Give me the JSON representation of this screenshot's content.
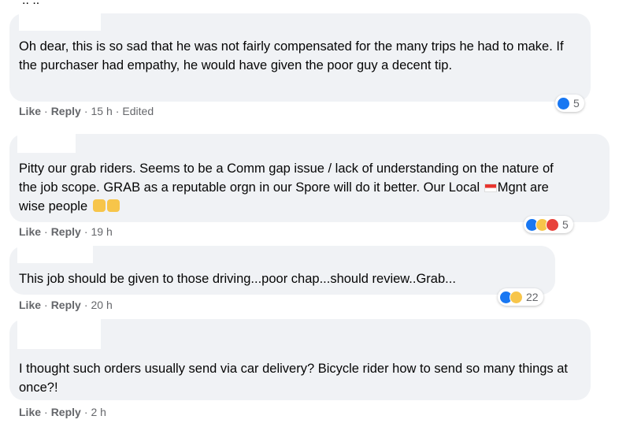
{
  "top_fragment": ".. ..",
  "comments": [
    {
      "text": "Oh dear, this is so sad that he was not fairly compensated for the many trips he had to make. If the purchaser had empathy, he would have given the poor guy a decent tip.",
      "like_label": "Like",
      "reply_label": "Reply",
      "time": "15 h",
      "edited": "Edited",
      "reaction_count": "5",
      "reaction_icons": [
        "like-icon"
      ]
    },
    {
      "text_part1": "Pitty our grab riders. Seems to be a Comm gap issue / lack of understanding on the nature of the job scope. GRAB as a reputable orgn in our Spore will do it better. Our Local ",
      "text_part2": "Mgnt are wise people",
      "like_label": "Like",
      "reply_label": "Reply",
      "time": "19 h",
      "reaction_count": "5",
      "reaction_icons": [
        "like-icon",
        "wow-icon",
        "angry-icon"
      ]
    },
    {
      "text": "This job should be given to those driving...poor chap...should review..Grab...",
      "like_label": "Like",
      "reply_label": "Reply",
      "time": "20 h",
      "reaction_count": "22",
      "reaction_icons": [
        "like-icon",
        "wow-icon"
      ]
    },
    {
      "text": "I thought such orders usually send via car delivery? Bicycle rider how to send so many things at once?!",
      "like_label": "Like",
      "reply_label": "Reply",
      "time": "2 h"
    }
  ],
  "colors": {
    "bubble": "#f0f2f5",
    "meta_text": "#65676b",
    "like_blue": "#1877f2"
  }
}
